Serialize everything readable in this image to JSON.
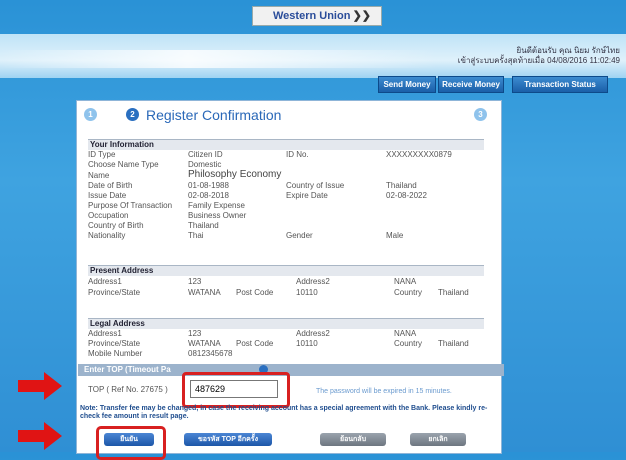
{
  "top_menu": {
    "service": "Western Union"
  },
  "header": {
    "user_line1": "ยินดีต้อนรับ คุณ นิยม รักษ์ไทย",
    "user_line2": "เข้าสู่ระบบครั้งสุดท้ายเมื่อ 04/08/2016 11:02:49"
  },
  "nav": {
    "send": "Send Money",
    "receive": "Receive Money",
    "status": "Transaction Status"
  },
  "steps": {
    "step1": "1",
    "step2": "2",
    "step3": "3",
    "title": "Register Confirmation"
  },
  "info": {
    "section": "Your Information",
    "id_type_label": "ID Type",
    "id_type": "Citizen ID",
    "id_no_label": "ID No.",
    "id_no": "XXXXXXXXX0879",
    "choose_name_label": "Choose Name Type",
    "choose_name": "Domestic",
    "name_label": "Name",
    "name": "Philosophy Economy",
    "dob_label": "Date of Birth",
    "dob": "01-08-1988",
    "country_issue_label": "Country of Issue",
    "country_issue": "Thailand",
    "issue_date_label": "Issue Date",
    "issue_date": "02-08-2018",
    "expire_date_label": "Expire Date",
    "expire_date": "02-08-2022",
    "purpose_label": "Purpose Of Transaction",
    "purpose": "Family Expense",
    "occupation_label": "Occupation",
    "occupation": "Business Owner",
    "cob_label": "Country of Birth",
    "cob": "Thailand",
    "nationality_label": "Nationality",
    "nationality": "Thai",
    "gender_label": "Gender",
    "gender": "Male"
  },
  "present": {
    "section": "Present Address",
    "addr1_label": "Address1",
    "addr1": "123",
    "addr2_label": "Address2",
    "addr2": "NANA",
    "province_label": "Province/State",
    "province": "WATANA",
    "postcode_label": "Post Code",
    "postcode": "10110",
    "country_label": "Country",
    "country": "Thailand"
  },
  "legal": {
    "section": "Legal Address",
    "addr1_label": "Address1",
    "addr1": "123",
    "addr2_label": "Address2",
    "addr2": "NANA",
    "province_label": "Province/State",
    "province": "WATANA",
    "postcode_label": "Post Code",
    "postcode": "10110",
    "country_label": "Country",
    "country": "Thailand",
    "mobile_label": "Mobile Number",
    "mobile": "0812345678"
  },
  "top": {
    "section": "Enter TOP (Timeout Pa",
    "label": "TOP ( Ref No. 27675 )",
    "value": "487629",
    "expire_note": "The password will be expired in 15 minutes.",
    "note": "Note: Transfer fee may be changed, in case the receiving account has a special agreement with the Bank. Please kindly re-check fee amount in result page."
  },
  "buttons": {
    "confirm": "ยืนยัน",
    "request_top": "ขอรหัส TOP อีกครั้ง",
    "back": "ย้อนกลับ",
    "cancel": "ยกเลิก"
  }
}
